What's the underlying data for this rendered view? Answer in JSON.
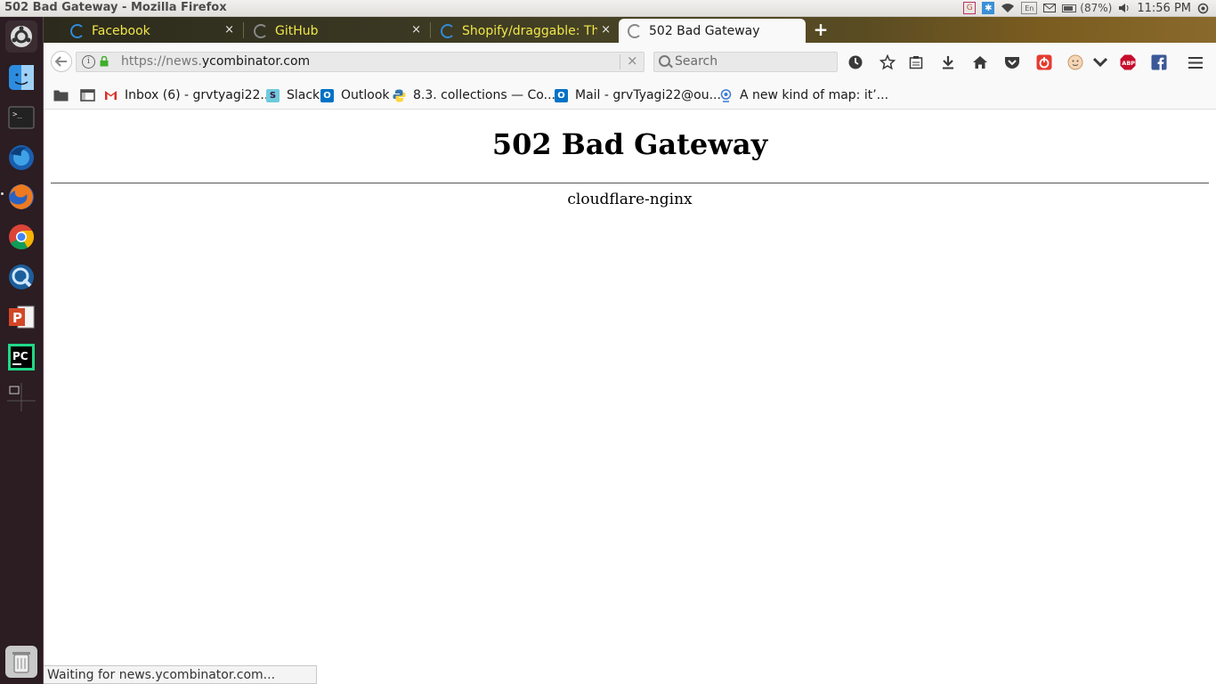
{
  "window": {
    "title": "502 Bad Gateway - Mozilla Firefox"
  },
  "system_tray": {
    "keyboard_layout": "En",
    "battery_percent": "(87%)",
    "clock": "11:56 PM",
    "icons": [
      "grammarly-icon",
      "bluetooth-icon",
      "wifi-icon",
      "keyboard-icon",
      "mail-icon",
      "battery-icon",
      "volume-icon"
    ]
  },
  "launcher": {
    "items": [
      {
        "name": "ubuntu-dash-icon"
      },
      {
        "name": "finder-icon"
      },
      {
        "name": "terminal-icon"
      },
      {
        "name": "firefox-developer-icon"
      },
      {
        "name": "firefox-icon"
      },
      {
        "name": "chrome-icon"
      },
      {
        "name": "quicktime-icon"
      },
      {
        "name": "powerpoint-icon"
      },
      {
        "name": "pycharm-icon"
      },
      {
        "name": "workspace-switcher-icon"
      },
      {
        "name": "trash-icon"
      }
    ]
  },
  "tabs": [
    {
      "label": "Facebook",
      "close": "×"
    },
    {
      "label": "GitHub",
      "close": "×"
    },
    {
      "label": "Shopify/draggable: The J",
      "close": "×"
    },
    {
      "label": "502 Bad Gateway",
      "close": "×",
      "active": true
    }
  ],
  "new_tab": "+",
  "navbar": {
    "url_prefix": "https://news.",
    "url_domain": "ycombinator.com",
    "clear": "×",
    "search_placeholder": "Search"
  },
  "bookmarks": [
    {
      "label": "Inbox (6) - grvtyagi22...",
      "icon": "gmail-icon",
      "color": "#d93025"
    },
    {
      "label": "Slack",
      "icon": "slack-icon",
      "color": "#4a154b"
    },
    {
      "label": "Outlook",
      "icon": "outlook-icon",
      "color": "#0072c6"
    },
    {
      "label": "8.3. collections — Co...",
      "icon": "python-icon",
      "color": "#3776ab"
    },
    {
      "label": "Mail - grvTyagi22@ou...",
      "icon": "outlook-mail-icon",
      "color": "#0072c6"
    },
    {
      "label": "A new kind of map: it’...",
      "icon": "webcam-icon",
      "color": "#3a7bd5"
    }
  ],
  "page": {
    "heading": "502 Bad Gateway",
    "server": "cloudflare-nginx"
  },
  "status": {
    "text": "Waiting for news.ycombinator.com..."
  }
}
